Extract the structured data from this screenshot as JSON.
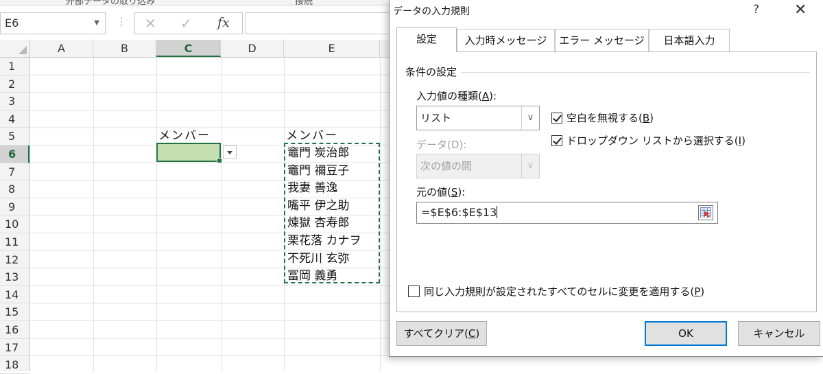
{
  "ribbon": {
    "partial_left": "外部データの取り込み",
    "partial_right": "接続"
  },
  "formula_bar": {
    "name_box": "E6",
    "fx_label": "fx",
    "cancel_glyph": "✕",
    "enter_glyph": "✓",
    "value": ""
  },
  "grid": {
    "columns": [
      "A",
      "B",
      "C",
      "D",
      "E"
    ],
    "active_column": "C",
    "rows": [
      "1",
      "2",
      "3",
      "4",
      "5",
      "6",
      "7",
      "8",
      "9",
      "10",
      "11",
      "12",
      "13",
      "14",
      "15",
      "16",
      "17",
      "18"
    ],
    "active_row": "6",
    "c5": "メンバー",
    "e5": "メンバー",
    "e_values": [
      "竈門 炭治郎",
      "竈門 禰豆子",
      "我妻 善逸",
      "嘴平 伊之助",
      "煉獄 杏寿郎",
      "栗花落 カナヲ",
      "不死川 玄弥",
      "冨岡 義勇"
    ]
  },
  "dialog": {
    "title": "データの入力規則",
    "help": "?",
    "close": "✕",
    "tabs": [
      "設定",
      "入力時メッセージ",
      "エラー メッセージ",
      "日本語入力"
    ],
    "active_tab": "設定",
    "group_title": "条件の設定",
    "allow_label_pre": "入力値の種類(",
    "allow_label_key": "A",
    "allow_label_post": "):",
    "allow_value": "リスト",
    "ignore_blank_pre": "空白を無視する(",
    "ignore_blank_key": "B",
    "ignore_blank_post": ")",
    "ignore_blank_checked": true,
    "in_cell_dropdown_pre": "ドロップダウン リストから選択する(",
    "in_cell_dropdown_key": "I",
    "in_cell_dropdown_post": ")",
    "in_cell_dropdown_checked": true,
    "data_label": "データ(D):",
    "data_value": "次の値の間",
    "source_label_pre": "元の値(",
    "source_label_key": "S",
    "source_label_post": "):",
    "source_value": "=$E$6:$E$13",
    "apply_all_pre": "同じ入力規則が設定されたすべてのセルに変更を適用する(",
    "apply_all_key": "P",
    "apply_all_post": ")",
    "apply_all_checked": false,
    "clear_all_pre": "すべてクリア(",
    "clear_all_key": "C",
    "clear_all_post": ")",
    "ok": "OK",
    "cancel": "キャンセル",
    "dropdown_glyph": "∨"
  },
  "colors": {
    "excel_green": "#217346",
    "selection_fill": "#c6e0b4",
    "default_button_border": "#0078d7"
  }
}
